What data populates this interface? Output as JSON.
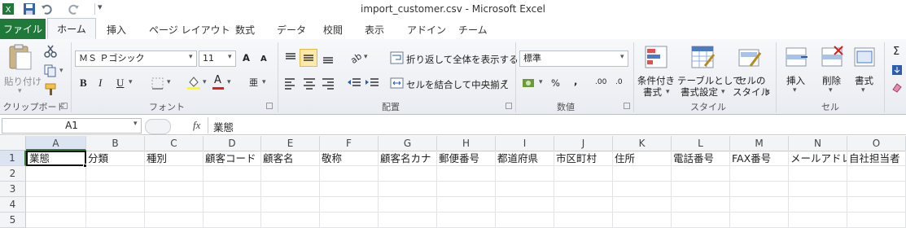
{
  "window": {
    "title": "import_customer.csv - Microsoft Excel"
  },
  "qat": {
    "icons": [
      "excel-logo-icon",
      "save-icon",
      "undo-icon",
      "redo-icon",
      "customize-qat-icon"
    ]
  },
  "tabs": [
    "ファイル",
    "ホーム",
    "挿入",
    "ページ レイアウト",
    "数式",
    "データ",
    "校閲",
    "表示",
    "アドイン",
    "チーム"
  ],
  "clipboard": {
    "paste": "貼り付け",
    "group": "クリップボード"
  },
  "font": {
    "name": "ＭＳ Ｐゴシック",
    "size": "11",
    "group": "フォント",
    "bold": "B",
    "italic": "I",
    "underline": "U",
    "grow": "A",
    "shrink": "A",
    "font_color": "A",
    "phonetic": "亜"
  },
  "alignment": {
    "wrap": "折り返して全体を表示する",
    "merge": "セルを結合して中央揃え",
    "group": "配置"
  },
  "number": {
    "format": "標準",
    "percent": "%",
    "comma": ",",
    "inc_dec": ".00",
    "dec_dec": ".0",
    "group": "数値"
  },
  "styles": {
    "conditional": [
      "条件付き",
      "書式"
    ],
    "table": [
      "テーブルとして",
      "書式設定"
    ],
    "cell": [
      "セルの",
      "スタイル"
    ],
    "group": "スタイル"
  },
  "cells": {
    "insert": "挿入",
    "delete": "削除",
    "format": "書式",
    "group": "セル"
  },
  "editing": {
    "sigma": "Σ"
  },
  "formula_bar": {
    "namebox": "A1",
    "fx": "fx",
    "content": "業態"
  },
  "columns": [
    "A",
    "B",
    "C",
    "D",
    "E",
    "F",
    "G",
    "H",
    "I",
    "J",
    "K",
    "L",
    "M",
    "N",
    "O"
  ],
  "rows": [
    "1",
    "2",
    "3",
    "4",
    "5"
  ],
  "row1": [
    "業態",
    "分類",
    "種別",
    "顧客コード",
    "顧客名",
    "敬称",
    "顧客名カナ",
    "郵便番号",
    "都道府県",
    "市区町村",
    "住所",
    "電話番号",
    "FAX番号",
    "メールアドレス",
    "自社担当者"
  ]
}
